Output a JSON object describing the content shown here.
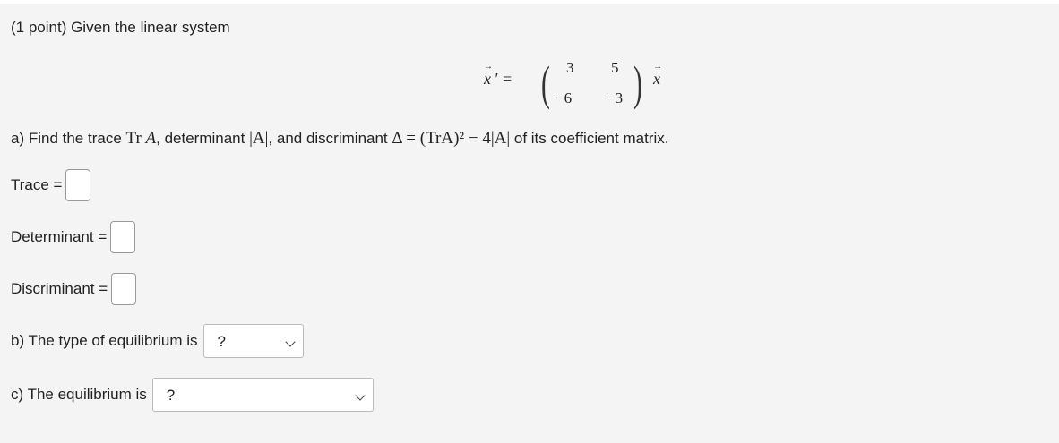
{
  "problem": {
    "intro": "(1 point) Given the linear system"
  },
  "equation": {
    "lhs": "x",
    "equals": "=",
    "matrix": [
      [
        "3",
        "5"
      ],
      [
        "−6",
        "−3"
      ]
    ],
    "rhs": "x"
  },
  "part_a": {
    "prefix": "a) Find the trace ",
    "tr_symbol": "Tr",
    "A1": "A",
    "mid1": ", determinant ",
    "det_expr": "|A|",
    "mid2": ", and discriminant ",
    "disc_expr": "Δ = (TrA)² − 4|A|",
    "suffix": " of its coefficient matrix."
  },
  "fields": {
    "trace_label": "Trace =",
    "trace_value": "",
    "determinant_label": "Determinant =",
    "determinant_value": "",
    "discriminant_label": "Discriminant =",
    "discriminant_value": ""
  },
  "part_b": {
    "label": "b) The type of equilibrium is",
    "selected": "?"
  },
  "part_c": {
    "label": "c) The equilibrium is",
    "selected": "?"
  }
}
